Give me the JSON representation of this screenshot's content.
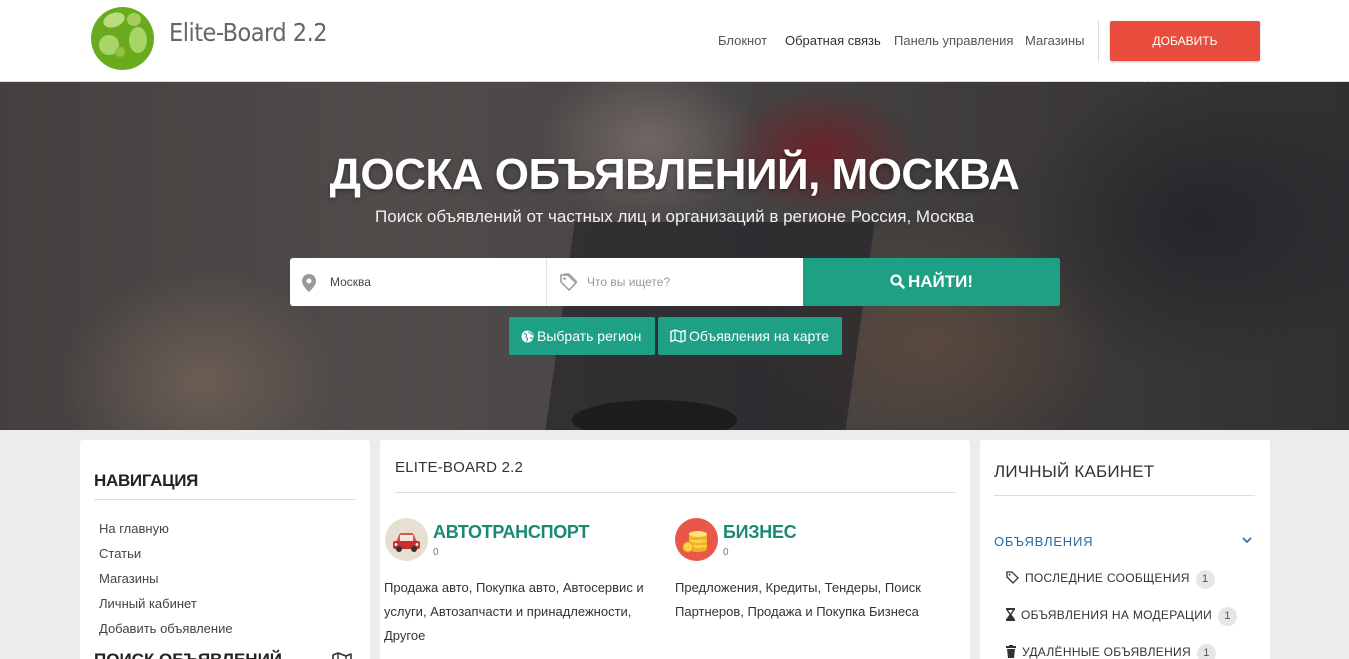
{
  "header": {
    "brand": "Elite-Board 2.2",
    "nav": [
      {
        "label": "Блокнот"
      },
      {
        "label": "Обратная связь"
      },
      {
        "label": "Панель управления"
      },
      {
        "label": "Магазины"
      }
    ],
    "add_button": "ДОБАВИТЬ ОБЪЯВЛЕНИЕ"
  },
  "hero": {
    "title": "ДОСКА ОБЪЯВЛЕНИЙ, МОСКВА",
    "subtitle": "Поиск объявлений от частных лиц и организаций в регионе Россия, Москва",
    "search": {
      "city_value": "Москва",
      "query_placeholder": "Что вы ищете?",
      "button": "НАЙТИ!"
    },
    "region_button": "Выбрать регион",
    "map_button": "Объявления на карте"
  },
  "navigation": {
    "title": "НАВИГАЦИЯ",
    "links": [
      "На главную",
      "Статьи",
      "Магазины",
      "Личный кабинет",
      "Добавить объявление"
    ],
    "search_title": "ПОИСК ОБЪЯВЛЕНИЙ"
  },
  "main": {
    "title": "ELITE-BOARD 2.2",
    "categories": [
      {
        "name": "АВТОТРАНСПОРТ",
        "count": "0",
        "desc": [
          "Продажа авто, Покупка авто, Автосервис и",
          "услуги, Автозапчасти и принадлежности,",
          "Другое"
        ]
      },
      {
        "name": "БИЗНЕС",
        "count": "0",
        "desc": [
          "Предложения, Кредиты, Тендеры, Поиск",
          "Партнеров, Продажа и Покупка Бизнеса"
        ]
      }
    ]
  },
  "cabinet": {
    "title": "ЛИЧНЫЙ КАБИНЕТ",
    "section": "ОБЪЯВЛЕНИЯ",
    "items": [
      {
        "label": "ПОСЛЕДНИЕ СООБЩЕНИЯ",
        "count": "1"
      },
      {
        "label": "ОБЪЯВЛЕНИЯ НА МОДЕРАЦИИ",
        "count": "1"
      },
      {
        "label": "УДАЛЁННЫЕ ОБЪЯВЛЕНИЯ",
        "count": "1"
      }
    ]
  },
  "colors": {
    "accent": "#1da084",
    "add_button": "#e84c3d",
    "link_blue": "#2b6aa0"
  }
}
